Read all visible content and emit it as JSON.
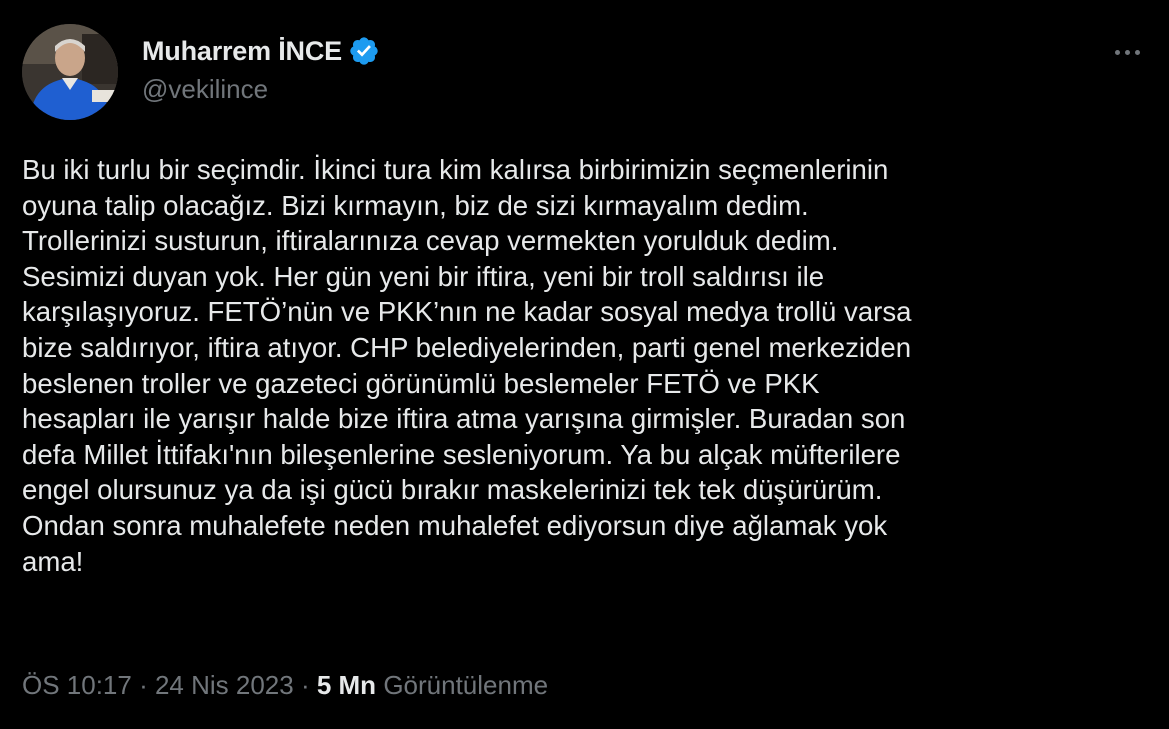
{
  "author": {
    "display_name": "Muharrem İNCE",
    "handle": "@vekilince",
    "verified": true,
    "avatar_icon": "profile-photo"
  },
  "menu": {
    "icon": "more-horizontal-icon"
  },
  "tweet": {
    "lines": [
      "Bu iki turlu bir seçimdir. İkinci tura kim kalırsa birbirimizin seçmenlerinin",
      "oyuna talip olacağız. Bizi kırmayın, biz de sizi kırmayalım dedim.",
      "Trollerinizi susturun, iftiralarınıza cevap vermekten yorulduk dedim.",
      "Sesimizi duyan yok. Her gün yeni bir iftira, yeni bir troll saldırısı ile",
      "karşılaşıyoruz. FETÖ’nün ve PKK’nın ne kadar sosyal medya trollü varsa",
      "bize saldırıyor, iftira atıyor. CHP belediyelerinden, parti genel merkeziden",
      "beslenen troller ve gazeteci görünümlü beslemeler FETÖ ve PKK",
      "hesapları ile yarışır halde bize iftira atma yarışına girmişler. Buradan son",
      "defa Millet İttifakı'nın bileşenlerine sesleniyorum. Ya bu alçak müfterilere",
      "engel olursunuz ya da işi gücü bırakır maskelerinizi tek tek düşürürüm.",
      "Ondan sonra muhalefete neden muhalefet ediyorsun diye ağlamak yok",
      "ama!"
    ]
  },
  "meta": {
    "time": "ÖS 10:17",
    "separator": " · ",
    "date": "24 Nis 2023",
    "separator2": " · ",
    "views_count": "5 Mn",
    "views_label": "Görüntülenme"
  },
  "colors": {
    "background": "#000000",
    "text": "#e7e9ea",
    "secondary": "#71767b",
    "verified_badge": "#1d9bf0"
  }
}
